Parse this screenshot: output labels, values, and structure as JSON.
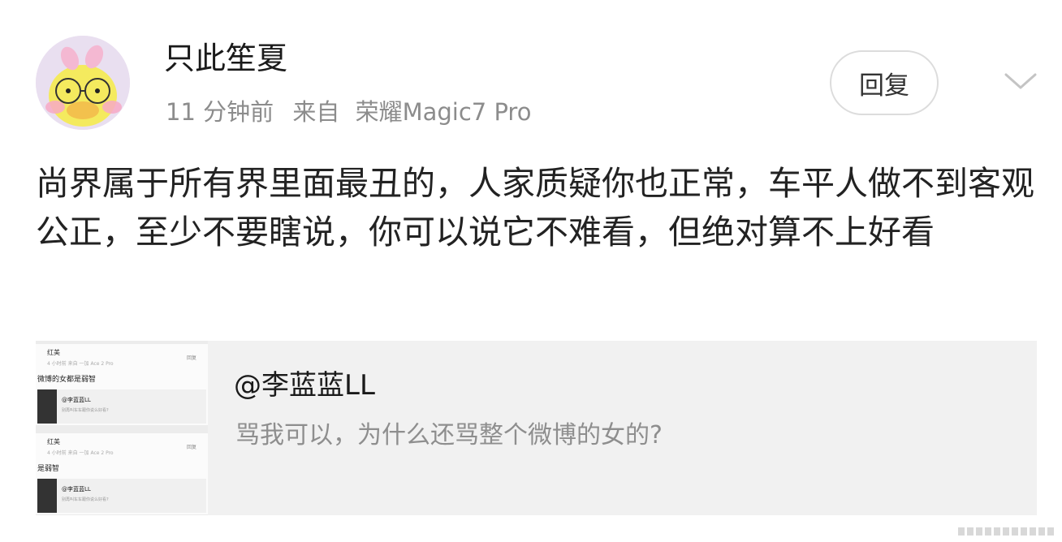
{
  "post": {
    "username": "只此笙夏",
    "time": "11 分钟前",
    "source_prefix": "来自",
    "source_device": "荣耀Magic7 Pro",
    "reply_label": "回复",
    "text": "尚界属于所有界里面最丑的，人家质疑你也正常，车平人做不到客观公正，至少不要瞎说，你可以说它不难看，但绝对算不上好看"
  },
  "quote": {
    "author": "@李蓝蓝LL",
    "text": "骂我可以，为什么还骂整个微博的女的?",
    "thumbnail": {
      "posts": [
        {
          "name": "红美",
          "meta": "4 小时前  来自 一加 Ace 2 Pro",
          "reply": "回复",
          "text": "微博的女都是弱智",
          "quote_name": "@李蓝蓝LL",
          "quote_text": "别再叫车车跟你说么好看?"
        },
        {
          "name": "红美",
          "meta": "4 小时前  来自 一加 Ace 2 Pro",
          "reply": "回复",
          "text": "是弱智",
          "quote_name": "@李蓝蓝LL",
          "quote_text": "别再叫车车跟你说么好看?"
        }
      ]
    }
  },
  "colors": {
    "text_primary": "#222222",
    "text_secondary": "#8c8c8c",
    "card_bg": "#f1f1f1",
    "border": "#dcdcdc"
  },
  "icons": {
    "more": "chevron-down-icon",
    "avatar": "duck-avatar-icon"
  }
}
